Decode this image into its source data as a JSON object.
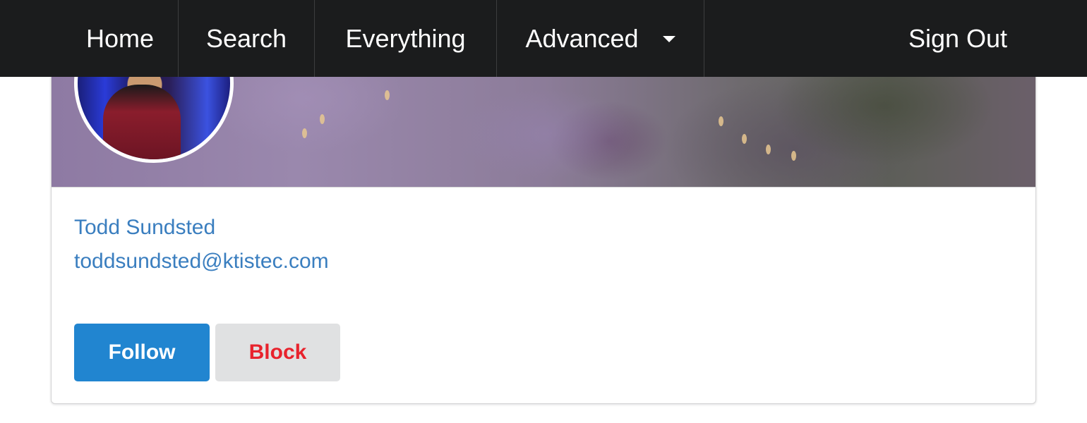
{
  "nav": {
    "items": [
      {
        "label": "Home"
      },
      {
        "label": "Search"
      },
      {
        "label": "Everything"
      },
      {
        "label": "Advanced",
        "has_dropdown": true
      }
    ],
    "sign_out": "Sign Out"
  },
  "profile": {
    "name": "Todd Sundsted",
    "handle": "toddsundsted@ktistec.com",
    "actions": {
      "follow": "Follow",
      "block": "Block"
    }
  },
  "colors": {
    "menu_bg": "#1b1c1d",
    "link": "#3a7ebf",
    "follow_bg": "#2185d0",
    "block_text": "#e8232d",
    "block_bg": "#e0e1e2"
  },
  "icons": {
    "advanced_dropdown": "caret-down-icon"
  }
}
